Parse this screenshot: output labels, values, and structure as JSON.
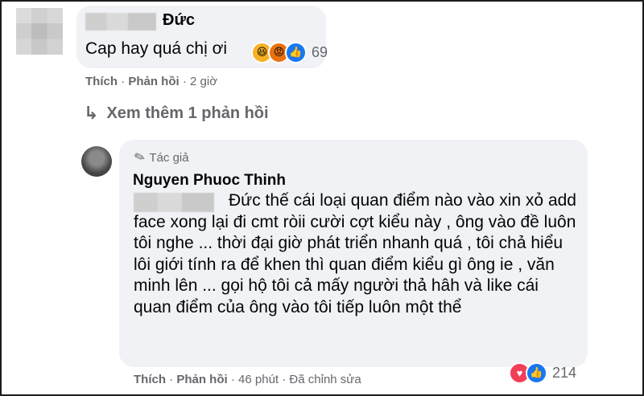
{
  "comment": {
    "author_suffix": "Đức",
    "text": "Cap hay quá chị ơi",
    "reaction_count": "69",
    "reactions": [
      "haha-icon",
      "angry-icon",
      "like-icon"
    ],
    "action_like": "Thích",
    "action_reply": "Phản hồi",
    "time": "2 giờ"
  },
  "view_more": {
    "label": "Xem thêm 1 phản hồi"
  },
  "reply": {
    "badge": "Tác giả",
    "author": "Nguyen Phuoc Thinh",
    "text": "Đức thế cái loại quan điểm nào vào xin xỏ add face xong lại đi cmt ròii cười cợt kiểu này , ông vào đề luôn tôi nghe ... thời đại giờ phát triển nhanh quá , tôi chả hiểu lôi giới tính ra để khen thì quan điểm kiểu gì ông ie , văn minh lên ... gọi hộ tôi cả mấy người thả hâh và like cái quan điểm của ông vào tôi tiếp luôn một thể",
    "reaction_count": "214",
    "reactions": [
      "love-icon",
      "like-icon"
    ],
    "action_like": "Thích",
    "action_reply": "Phản hồi",
    "time": "46 phút",
    "edited": "Đã chỉnh sửa"
  }
}
